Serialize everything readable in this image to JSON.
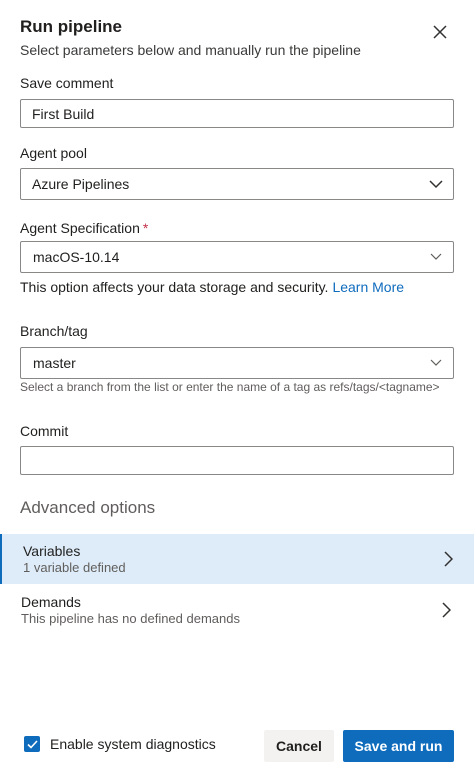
{
  "header": {
    "title": "Run pipeline",
    "subtitle": "Select parameters below and manually run the pipeline"
  },
  "save_comment": {
    "label": "Save comment",
    "value": "First Build"
  },
  "agent_pool": {
    "label": "Agent pool",
    "value": "Azure Pipelines"
  },
  "agent_spec": {
    "label": "Agent Specification",
    "required_mark": "*",
    "value": "macOS-10.14",
    "note": "This option affects your data storage and security.",
    "link": "Learn More"
  },
  "branch": {
    "label": "Branch/tag",
    "value": "master",
    "help": "Select a branch from the list or enter the name of a tag as refs/tags/<tagname>"
  },
  "commit": {
    "label": "Commit",
    "value": ""
  },
  "advanced": {
    "title": "Advanced options",
    "items": [
      {
        "title": "Variables",
        "subtitle": "1 variable defined",
        "selected": true
      },
      {
        "title": "Demands",
        "subtitle": "This pipeline has no defined demands",
        "selected": false
      }
    ]
  },
  "footer": {
    "diagnostics_label": "Enable system diagnostics",
    "diagnostics_checked": true,
    "cancel_label": "Cancel",
    "run_label": "Save and run"
  },
  "colors": {
    "accent": "#0f6cbd",
    "selected_row": "#deecf9",
    "required": "#c4314b"
  },
  "icons": {
    "close": "close-icon",
    "dropdown": "chevron-down-icon",
    "row": "chevron-right-icon",
    "check": "checkmark-icon"
  }
}
